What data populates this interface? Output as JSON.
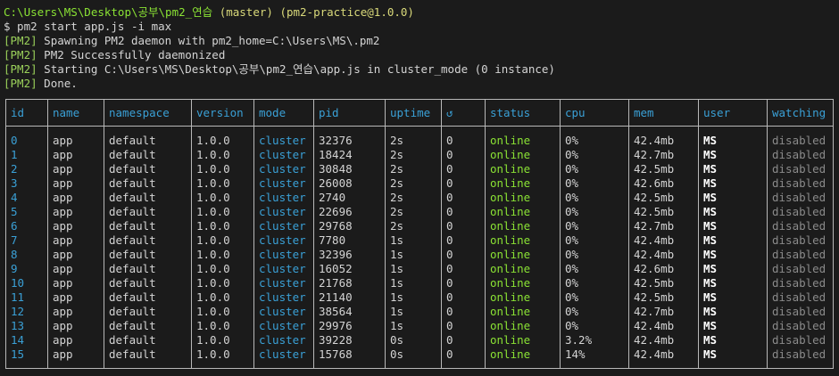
{
  "prompt": {
    "path": "C:\\Users\\MS\\Desktop\\공부\\pm2_연습",
    "branch": "(master)",
    "package": "(pm2-practice@1.0.0)",
    "command": "$ pm2 start app.js -i max"
  },
  "log_lines": [
    {
      "tag": "[PM2]",
      "text": " Spawning PM2 daemon with pm2_home=C:\\Users\\MS\\.pm2"
    },
    {
      "tag": "[PM2]",
      "text": " PM2 Successfully daemonized"
    },
    {
      "tag": "[PM2]",
      "text": " Starting C:\\Users\\MS\\Desktop\\공부\\pm2_연습\\app.js in cluster_mode (0 instance)"
    },
    {
      "tag": "[PM2]",
      "text": " Done."
    }
  ],
  "table": {
    "columns": [
      "id",
      "name",
      "namespace",
      "version",
      "mode",
      "pid",
      "uptime",
      "↺",
      "status",
      "cpu",
      "mem",
      "user",
      "watching"
    ],
    "rows": [
      [
        "0",
        "app",
        "default",
        "1.0.0",
        "cluster",
        "32376",
        "2s",
        "0",
        "online",
        "0%",
        "42.4mb",
        "MS",
        "disabled"
      ],
      [
        "1",
        "app",
        "default",
        "1.0.0",
        "cluster",
        "18424",
        "2s",
        "0",
        "online",
        "0%",
        "42.7mb",
        "MS",
        "disabled"
      ],
      [
        "2",
        "app",
        "default",
        "1.0.0",
        "cluster",
        "30848",
        "2s",
        "0",
        "online",
        "0%",
        "42.5mb",
        "MS",
        "disabled"
      ],
      [
        "3",
        "app",
        "default",
        "1.0.0",
        "cluster",
        "26008",
        "2s",
        "0",
        "online",
        "0%",
        "42.6mb",
        "MS",
        "disabled"
      ],
      [
        "4",
        "app",
        "default",
        "1.0.0",
        "cluster",
        "2740",
        "2s",
        "0",
        "online",
        "0%",
        "42.5mb",
        "MS",
        "disabled"
      ],
      [
        "5",
        "app",
        "default",
        "1.0.0",
        "cluster",
        "22696",
        "2s",
        "0",
        "online",
        "0%",
        "42.5mb",
        "MS",
        "disabled"
      ],
      [
        "6",
        "app",
        "default",
        "1.0.0",
        "cluster",
        "29768",
        "2s",
        "0",
        "online",
        "0%",
        "42.7mb",
        "MS",
        "disabled"
      ],
      [
        "7",
        "app",
        "default",
        "1.0.0",
        "cluster",
        "7780",
        "1s",
        "0",
        "online",
        "0%",
        "42.4mb",
        "MS",
        "disabled"
      ],
      [
        "8",
        "app",
        "default",
        "1.0.0",
        "cluster",
        "32396",
        "1s",
        "0",
        "online",
        "0%",
        "42.4mb",
        "MS",
        "disabled"
      ],
      [
        "9",
        "app",
        "default",
        "1.0.0",
        "cluster",
        "16052",
        "1s",
        "0",
        "online",
        "0%",
        "42.6mb",
        "MS",
        "disabled"
      ],
      [
        "10",
        "app",
        "default",
        "1.0.0",
        "cluster",
        "21768",
        "1s",
        "0",
        "online",
        "0%",
        "42.5mb",
        "MS",
        "disabled"
      ],
      [
        "11",
        "app",
        "default",
        "1.0.0",
        "cluster",
        "21140",
        "1s",
        "0",
        "online",
        "0%",
        "42.5mb",
        "MS",
        "disabled"
      ],
      [
        "12",
        "app",
        "default",
        "1.0.0",
        "cluster",
        "38564",
        "1s",
        "0",
        "online",
        "0%",
        "42.7mb",
        "MS",
        "disabled"
      ],
      [
        "13",
        "app",
        "default",
        "1.0.0",
        "cluster",
        "29976",
        "1s",
        "0",
        "online",
        "0%",
        "42.4mb",
        "MS",
        "disabled"
      ],
      [
        "14",
        "app",
        "default",
        "1.0.0",
        "cluster",
        "39228",
        "0s",
        "0",
        "online",
        "3.2%",
        "42.4mb",
        "MS",
        "disabled"
      ],
      [
        "15",
        "app",
        "default",
        "1.0.0",
        "cluster",
        "15768",
        "0s",
        "0",
        "online",
        "14%",
        "42.4mb",
        "MS",
        "disabled"
      ]
    ]
  },
  "colors": {
    "background": "#1b1b1b",
    "path": "#8ae234",
    "header": "#3aa0d6",
    "online": "#8ae234",
    "disabled": "#8a8a8a"
  }
}
